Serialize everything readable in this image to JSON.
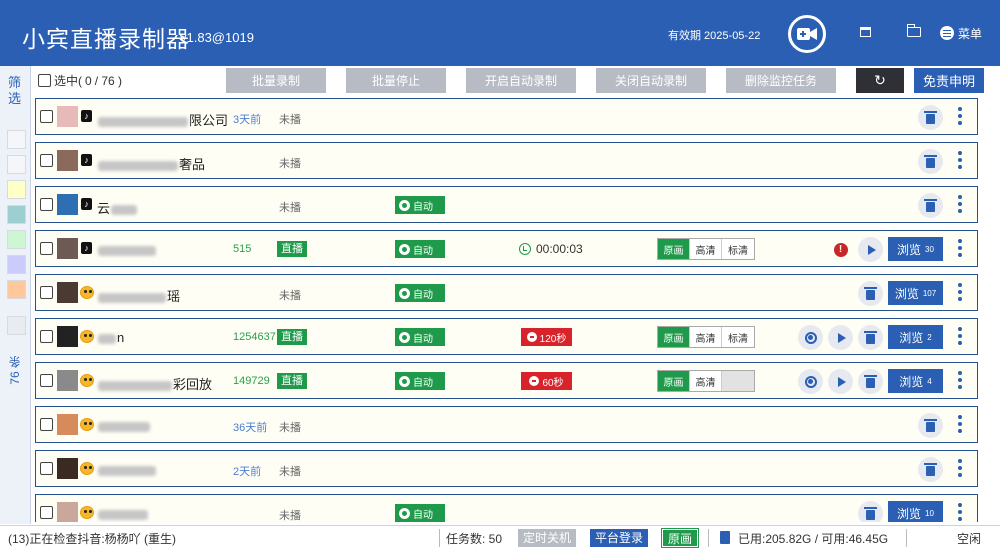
{
  "app": {
    "title": "小宾直播录制器",
    "version": "v1.83@1019",
    "expiry": "有效期 2025-05-22",
    "menu_label": "菜单"
  },
  "sidebar": {
    "filter_label": "筛选",
    "count_label": "76 条",
    "swatches": [
      "#ffffc8",
      "#9ecfd0",
      "#cdf7d3",
      "#ccccfc",
      "#ffc89a"
    ]
  },
  "toolbar": {
    "select_label": "选中(",
    "selected_count": "0",
    "total_label": "/  76 )",
    "buttons": [
      "批量录制",
      "批量停止",
      "开启自动录制",
      "关闭自动录制",
      "删除监控任务"
    ],
    "disclaimer": "免责申明"
  },
  "rows": [
    {
      "platform": "tiktok",
      "name_pre": "",
      "name_suf": "限公司",
      "ago": "3天前",
      "status": "未播",
      "avatar": "#e8b9b9"
    },
    {
      "platform": "tiktok",
      "name_pre": "",
      "name_suf": "奢品",
      "status": "未播",
      "avatar": "#8a6a5a"
    },
    {
      "platform": "tiktok",
      "name_pre": "云",
      "name_suf": "",
      "status": "未播",
      "auto": "自动",
      "avatar": "#2d6fb0"
    },
    {
      "platform": "tiktok",
      "name_pre": "",
      "name_suf": "",
      "viewers": "515",
      "status": "直播",
      "auto": "自动",
      "timer": "00:00:03",
      "qualities": [
        "原画",
        "高清",
        "标清"
      ],
      "browse": "浏览",
      "browse_count": "30",
      "avatar": "#6e5a55"
    },
    {
      "platform": "douyin",
      "name_pre": "",
      "name_suf": "瑶",
      "status": "未播",
      "auto": "自动",
      "browse": "浏览",
      "browse_count": "107",
      "avatar": "#4a3a32"
    },
    {
      "platform": "douyin",
      "name_pre": "",
      "name_suf": "n",
      "viewers": "1254637",
      "status": "直播",
      "auto": "自动",
      "countdown": "120秒",
      "qualities": [
        "原画",
        "高清",
        "标清"
      ],
      "browse": "浏览",
      "browse_count": "2",
      "avatar": "#222"
    },
    {
      "platform": "douyin",
      "name_pre": "",
      "name_suf": "彩回放",
      "viewers": "149729",
      "status": "直播",
      "auto": "自动",
      "countdown": "60秒",
      "qualities": [
        "原画",
        "高清",
        ""
      ],
      "browse": "浏览",
      "browse_count": "4",
      "avatar": "#8a8a8a"
    },
    {
      "platform": "douyin",
      "name_pre": "",
      "name_suf": "",
      "ago": "36天前",
      "status": "未播",
      "avatar": "#d88b5a"
    },
    {
      "platform": "douyin",
      "name_pre": "",
      "name_suf": "",
      "ago": "2天前",
      "status": "未播",
      "avatar": "#3a2a22"
    },
    {
      "platform": "douyin",
      "name_pre": "",
      "name_suf": "",
      "status": "未播",
      "auto": "自动",
      "browse": "浏览",
      "browse_count": "10",
      "avatar": "#c9a79a"
    }
  ],
  "statusbar": {
    "checking": "(13)正在检查抖音:杨杨吖 (重生)",
    "tasks": "任务数: 50",
    "shutdown": "定时关机",
    "login": "平台登录",
    "quality": "原画",
    "disk": "已用:205.82G / 可用:46.45G",
    "idle": "空闲"
  }
}
